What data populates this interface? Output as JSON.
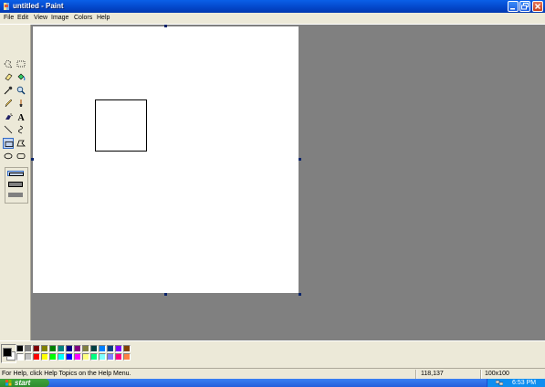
{
  "window": {
    "title": "untitled - Paint"
  },
  "menu": [
    "File",
    "Edit",
    "View",
    "Image",
    "Colors",
    "Help"
  ],
  "tools": [
    {
      "name": "free-form-select-icon"
    },
    {
      "name": "select-icon"
    },
    {
      "name": "eraser-icon"
    },
    {
      "name": "fill-icon"
    },
    {
      "name": "pick-color-icon"
    },
    {
      "name": "magnifier-icon"
    },
    {
      "name": "pencil-icon"
    },
    {
      "name": "brush-icon"
    },
    {
      "name": "airbrush-icon"
    },
    {
      "name": "text-icon"
    },
    {
      "name": "line-icon"
    },
    {
      "name": "curve-icon"
    },
    {
      "name": "rectangle-icon",
      "active": true
    },
    {
      "name": "polygon-icon"
    },
    {
      "name": "ellipse-icon"
    },
    {
      "name": "rounded-rectangle-icon"
    }
  ],
  "colors": {
    "foreground": "#000000",
    "background": "#ffffff",
    "palette_top": [
      "#000000",
      "#808080",
      "#800000",
      "#808000",
      "#008000",
      "#008080",
      "#000080",
      "#800080",
      "#808040",
      "#004040",
      "#0080ff",
      "#004080",
      "#8000ff",
      "#804000"
    ],
    "palette_bottom": [
      "#ffffff",
      "#c0c0c0",
      "#ff0000",
      "#ffff00",
      "#00ff00",
      "#00ffff",
      "#0000ff",
      "#ff00ff",
      "#ffff80",
      "#00ff80",
      "#80ffff",
      "#8080ff",
      "#ff0080",
      "#ff8040"
    ]
  },
  "status": {
    "help": "For Help, click Help Topics on the Help Menu.",
    "coords": "118,137",
    "size": "100x100"
  },
  "taskbar": {
    "start_label": "start",
    "clock": "6:53 PM"
  }
}
